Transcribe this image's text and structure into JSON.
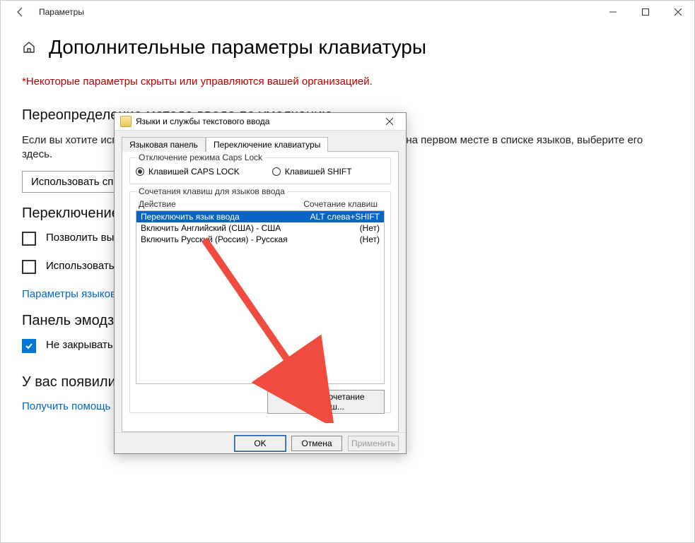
{
  "titlebar": {
    "title": "Параметры"
  },
  "page": {
    "heading": "Дополнительные параметры клавиатуры",
    "warning": "*Некоторые параметры скрыты или управляются вашей организацией.",
    "section1": "Переопределение метода ввода по умолчанию",
    "body1": "Если вы хотите использовать метод ввода, отличный от того, который указан на первом месте в списке языков, выберите его здесь.",
    "dropdown": "Использовать список языков (рекомендуется)",
    "section2": "Переключение методов ввода",
    "check1": "Позволить выбирать метод ввода для каждого окна приложения",
    "check2": "Использовать языковую панель рабочего стола, если она доступна",
    "link1": "Параметры языковой панели",
    "section3": "Панель эмодзи",
    "check3": "Не закрывать панель автоматически после ввода эмодзи",
    "section4": "У вас появились вопросы?",
    "link2": "Получить помощь"
  },
  "dialog": {
    "title": "Языки и службы текстового ввода",
    "tab1": "Языковая панель",
    "tab2": "Переключение клавиатуры",
    "group1": "Отключение режима Caps Lock",
    "radio1": "Клавишей CAPS LOCK",
    "radio2": "Клавишей SHIFT",
    "group2": "Сочетания клавиш для языков ввода",
    "col1": "Действие",
    "col2": "Сочетание клавиш",
    "rows": [
      {
        "action": "Переключить язык ввода",
        "keys": "ALT слева+SHIFT"
      },
      {
        "action": "Включить Английский (США) - США",
        "keys": "(Нет)"
      },
      {
        "action": "Включить Русский (Россия) - Русская",
        "keys": "(Нет)"
      }
    ],
    "changeBtn": "Сменить сочетание клавиш...",
    "ok": "OK",
    "cancel": "Отмена",
    "apply": "Применить"
  }
}
